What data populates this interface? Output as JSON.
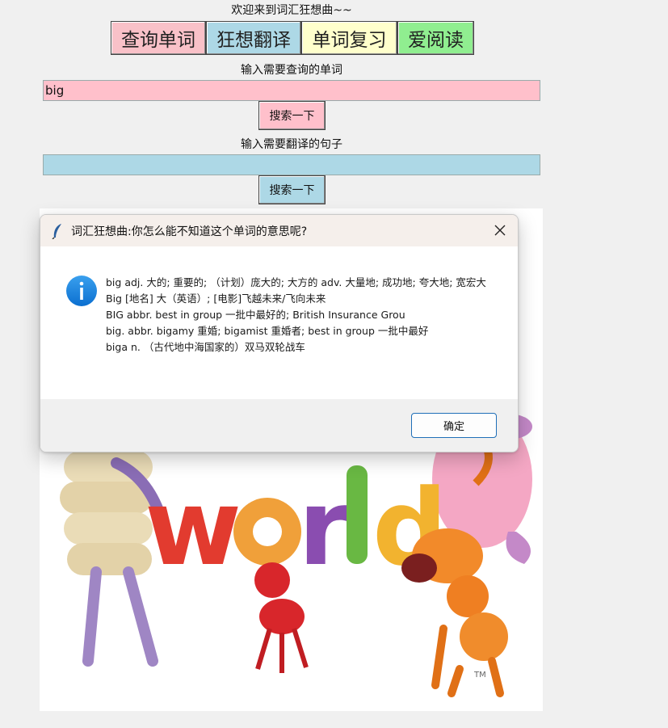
{
  "welcome": "欢迎来到词汇狂想曲~~",
  "tabs": [
    {
      "label": "查询单词",
      "color": "#f9c1c8"
    },
    {
      "label": "狂想翻译",
      "color": "#add8e6"
    },
    {
      "label": "单词复习",
      "color": "#ffffcc"
    },
    {
      "label": "爱阅读",
      "color": "#90ee90"
    }
  ],
  "query": {
    "label": "输入需要查询的单词",
    "value": "big",
    "color": "#ffc0cb",
    "button": "搜索一下"
  },
  "translate": {
    "label": "输入需要翻译的句子",
    "value": "",
    "color": "#add8e6",
    "button": "搜索一下"
  },
  "dialog": {
    "title": "词汇狂想曲:你怎么能不知道这个单词的意思呢?",
    "icon": "info-icon",
    "lines": [
      "big adj. 大的; 重要的; （计划）庞大的; 大方的 adv. 大量地; 成功地; 夸大地; 宽宏大",
      "Big [地名] 大（英语）; [电影]飞越未来/飞向未来",
      "BIG abbr. best in group 一批中最好的; British Insurance Grou",
      "big. abbr. bigamy 重婚; bigamist 重婚者; best in group 一批中最好",
      "biga n. （古代地中海国家的）双马双轮战车"
    ],
    "ok": "确定"
  },
  "artwork": {
    "text": "world",
    "tm": "TM"
  }
}
